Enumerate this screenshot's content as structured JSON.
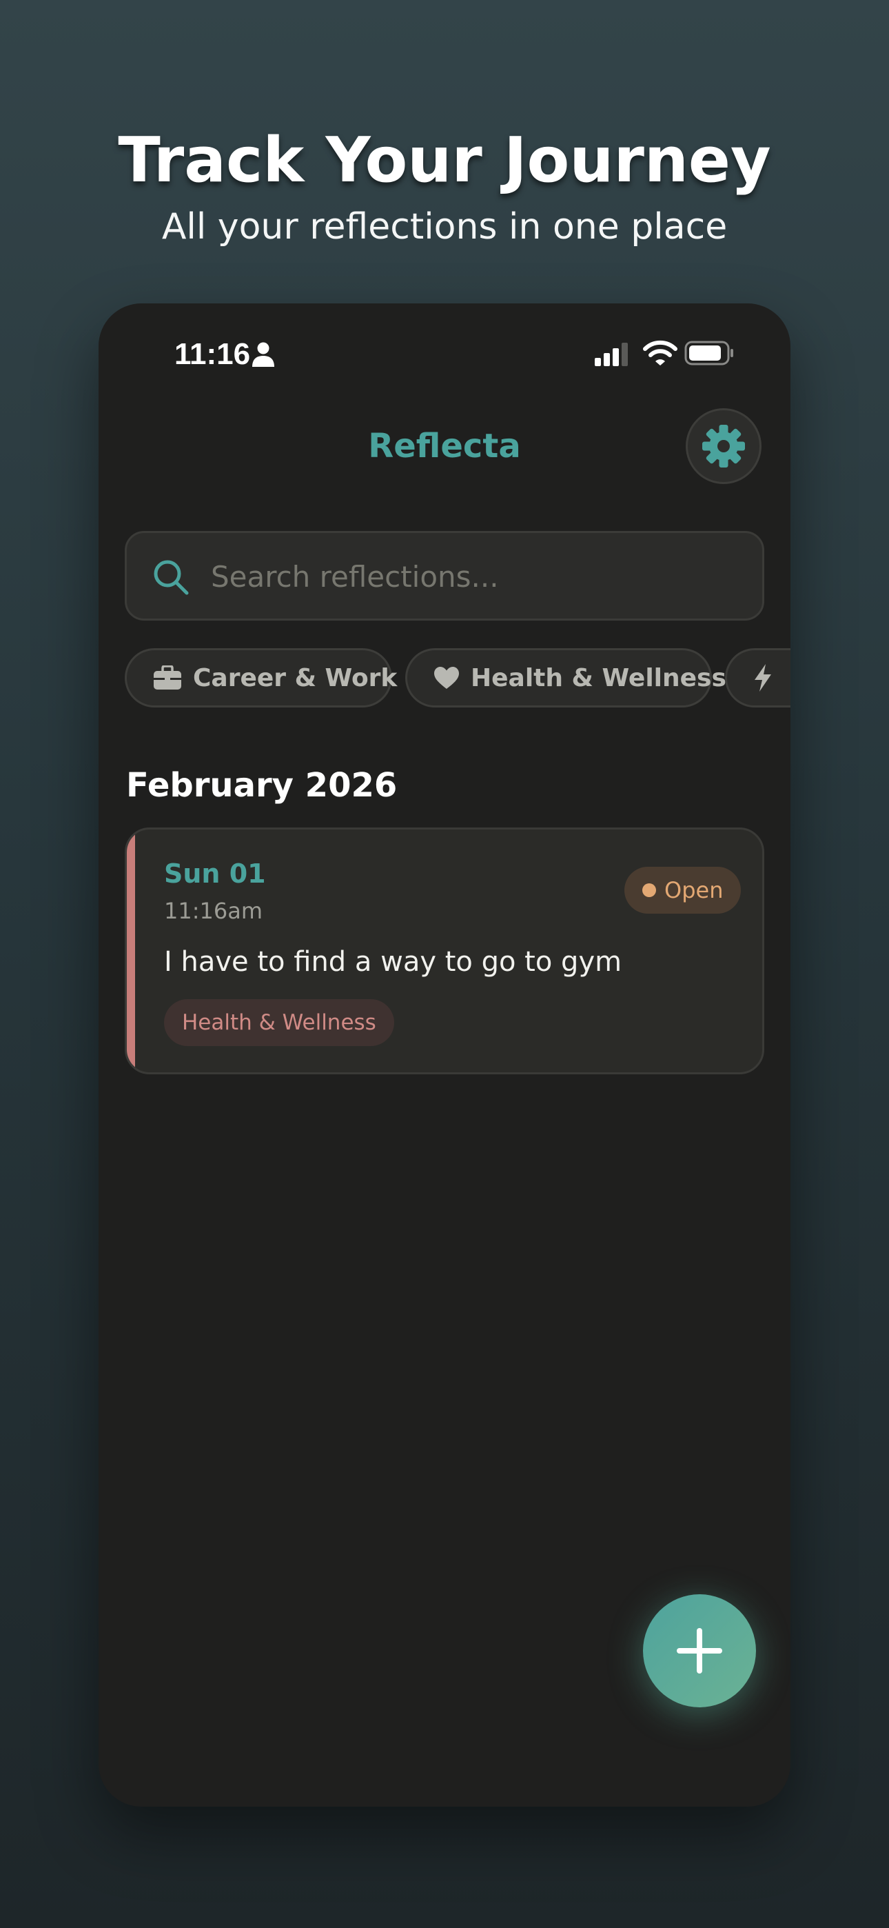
{
  "hero": {
    "title": "Track Your Journey",
    "subtitle": "All your reflections in one place"
  },
  "status_bar": {
    "time": "11:16",
    "icons": [
      "person-icon",
      "signal-icon",
      "wifi-icon",
      "battery-icon"
    ]
  },
  "header": {
    "app_title": "Reflecta",
    "settings_icon": "gear-icon"
  },
  "search": {
    "placeholder": "Search reflections...",
    "value": ""
  },
  "categories": [
    {
      "label": "Career & Work",
      "icon": "briefcase-icon"
    },
    {
      "label": "Health & Wellness",
      "icon": "heart-icon"
    },
    {
      "label": "",
      "icon": "lightning-icon"
    }
  ],
  "section": {
    "month": "February 2026"
  },
  "entries": [
    {
      "date": "Sun 01",
      "time": "11:16am",
      "status": "Open",
      "text": "I have to find a way to go to gym",
      "tag": "Health & Wellness"
    }
  ],
  "colors": {
    "accent": "#4aa39d",
    "card_accent": "#c87e7a",
    "status_open": "#e3a873",
    "background": "#1f1f1e"
  },
  "fab": {
    "icon": "plus-icon"
  }
}
